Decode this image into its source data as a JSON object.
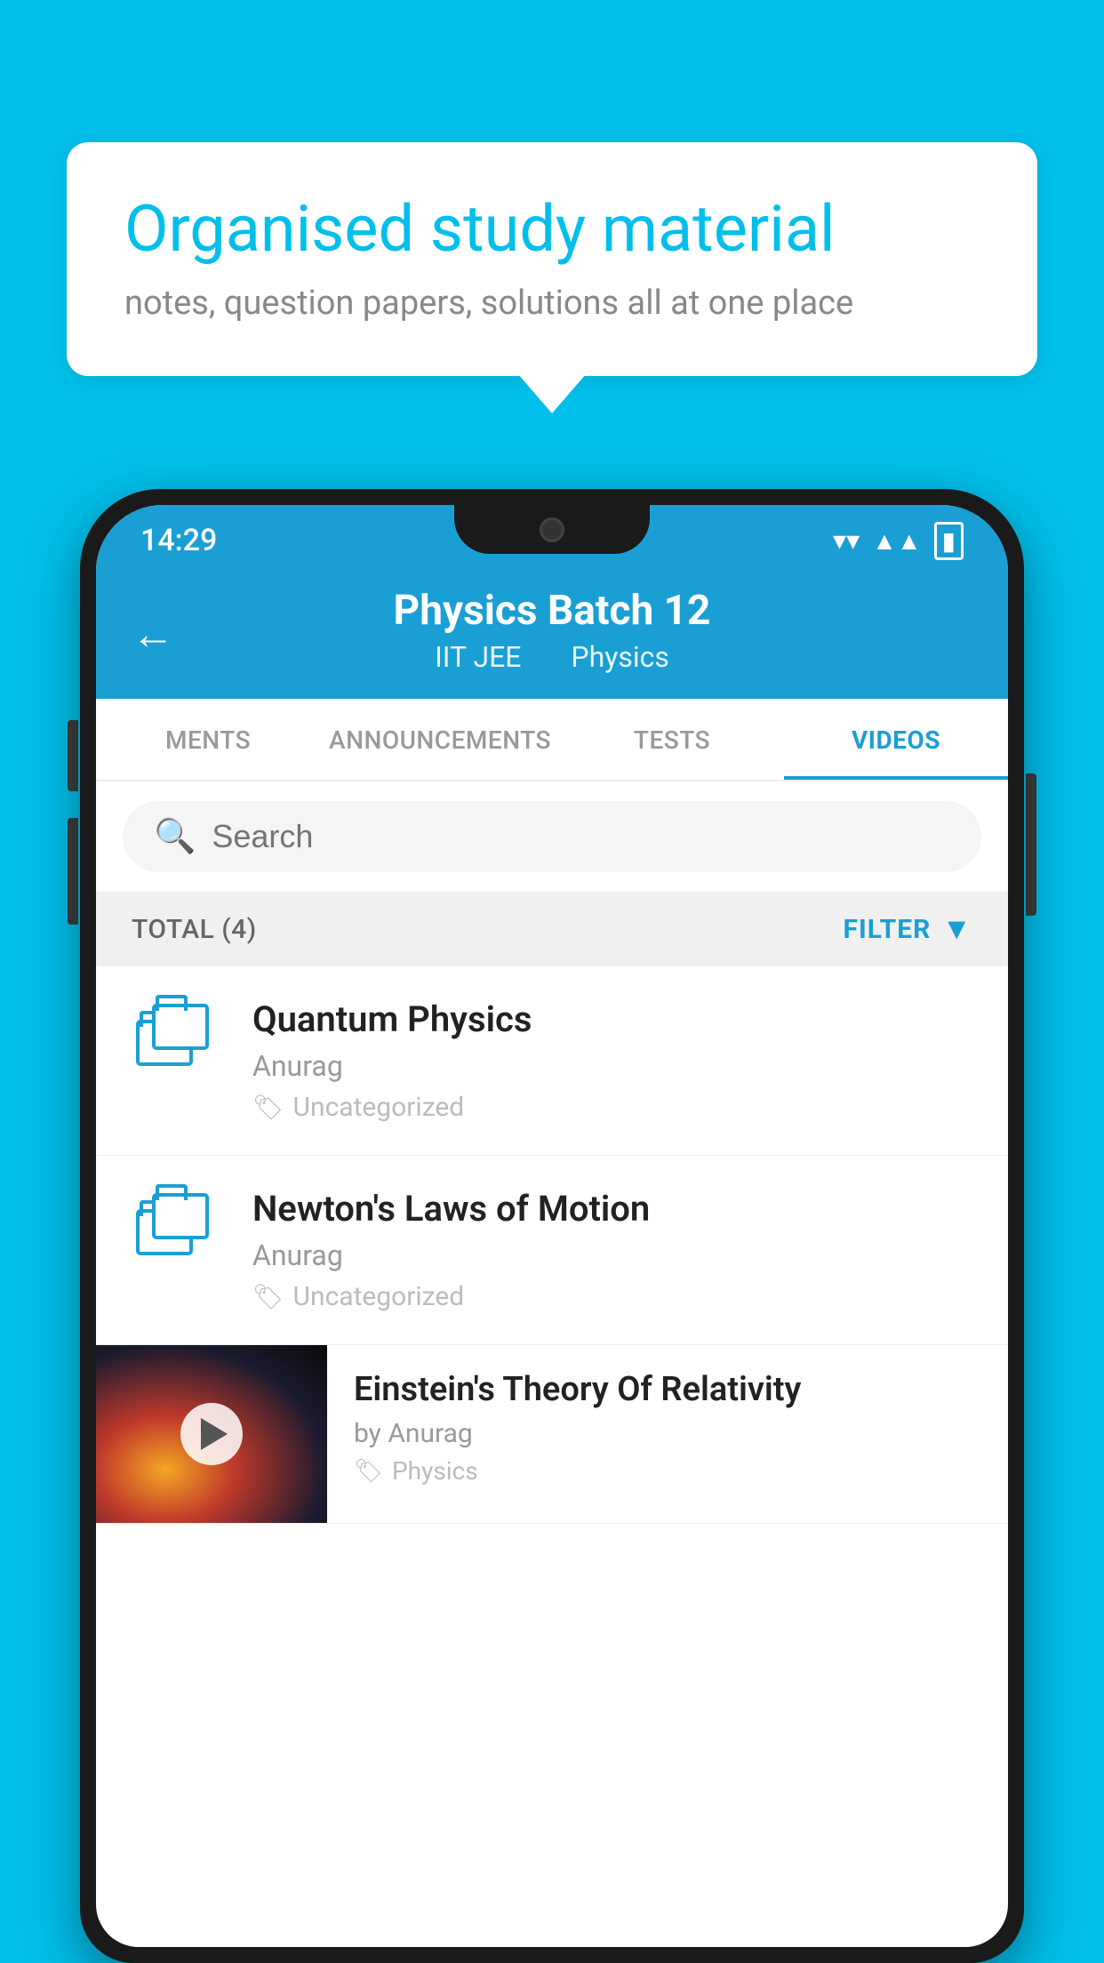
{
  "background_color": "#00BFEA",
  "bubble": {
    "title": "Organised study material",
    "subtitle": "notes, question papers, solutions all at one place"
  },
  "status_bar": {
    "time": "14:29",
    "wifi": "▾",
    "signal": "▾",
    "battery": "▮"
  },
  "header": {
    "back_label": "←",
    "title": "Physics Batch 12",
    "tag1": "IIT JEE",
    "tag2": "Physics"
  },
  "tabs": [
    {
      "label": "MENTS",
      "active": false
    },
    {
      "label": "ANNOUNCEMENTS",
      "active": false
    },
    {
      "label": "TESTS",
      "active": false
    },
    {
      "label": "VIDEOS",
      "active": true
    }
  ],
  "search": {
    "placeholder": "Search"
  },
  "filter_bar": {
    "total_label": "TOTAL (4)",
    "filter_label": "FILTER"
  },
  "videos": [
    {
      "id": 1,
      "title": "Quantum Physics",
      "author": "Anurag",
      "tag": "Uncategorized",
      "has_thumbnail": false
    },
    {
      "id": 2,
      "title": "Newton's Laws of Motion",
      "author": "Anurag",
      "tag": "Uncategorized",
      "has_thumbnail": false
    },
    {
      "id": 3,
      "title": "Einstein's Theory Of Relativity",
      "author": "by Anurag",
      "tag": "Physics",
      "has_thumbnail": true
    }
  ]
}
